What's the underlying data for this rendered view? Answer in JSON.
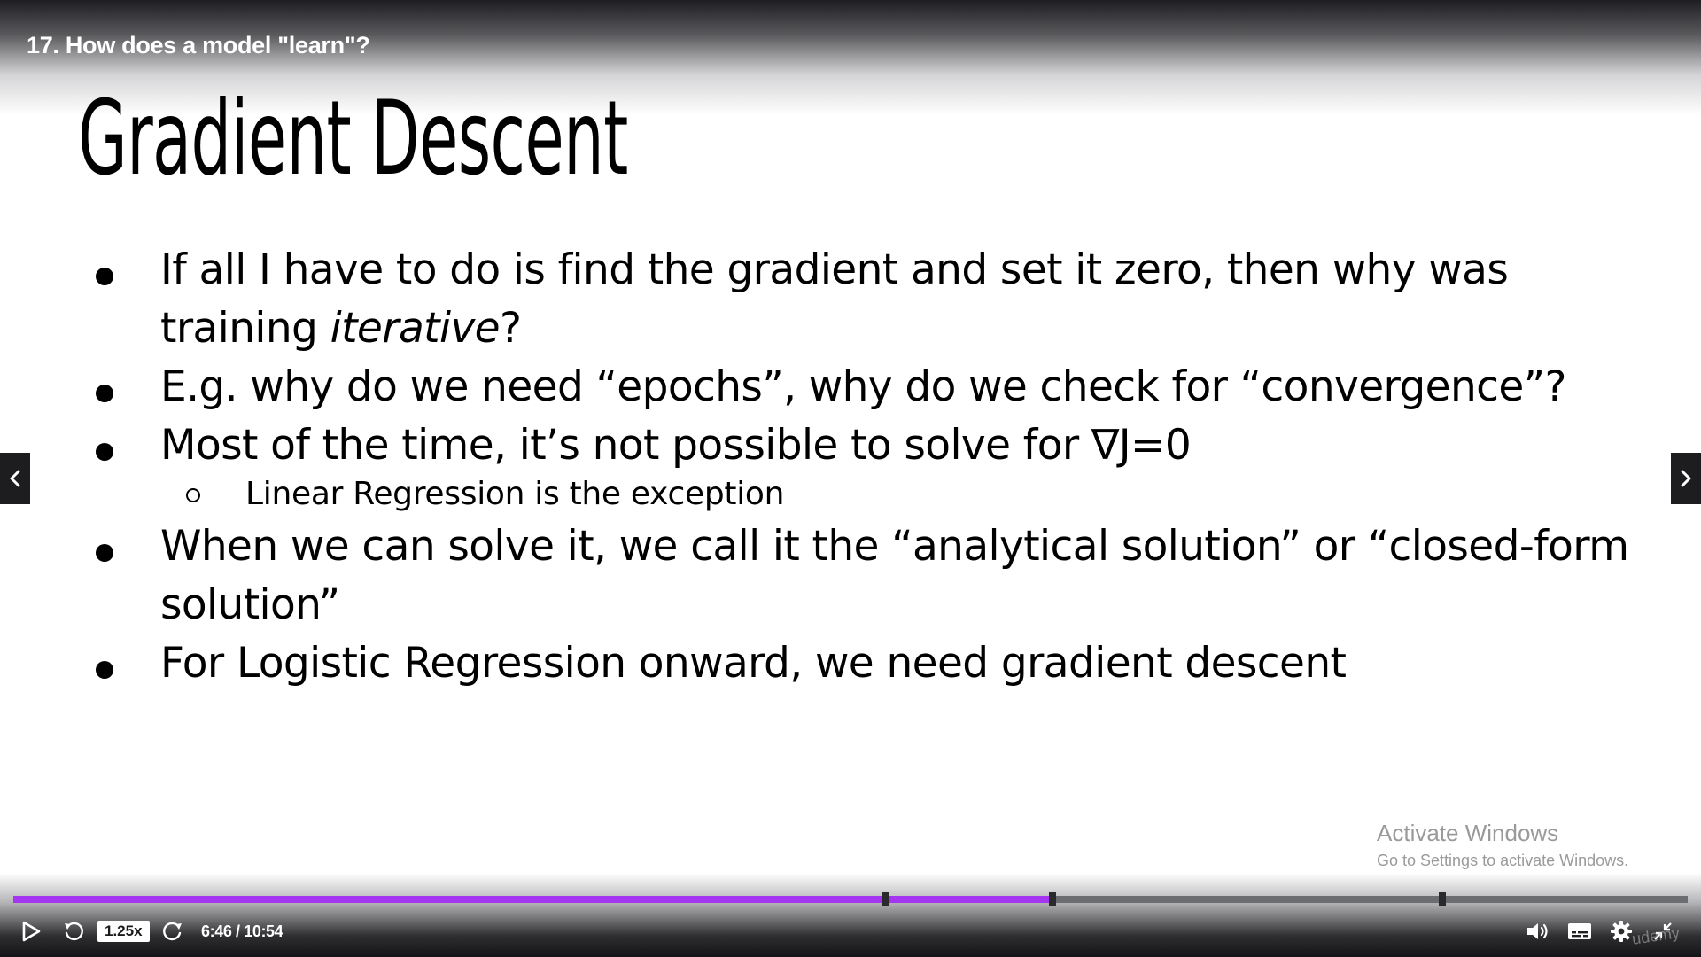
{
  "player": {
    "lecture_title": "17. How does a model \"learn\"?",
    "playback_speed": "1.25x",
    "time_display": "6:46 / 10:54",
    "progress_fraction": 0.6207,
    "chapter_markers_fraction": [
      0.5213,
      0.6207,
      0.8533
    ],
    "colors": {
      "progress_fill": "#a435f0",
      "progress_track": "#6b6d70"
    },
    "icons": [
      "play-icon",
      "rewind-icon",
      "forward-icon",
      "volume-icon",
      "captions-icon",
      "settings-icon",
      "exit-fullscreen-icon",
      "chevron-left-icon",
      "chevron-right-icon"
    ]
  },
  "slide": {
    "heading": "Gradient Descent",
    "bullets": [
      {
        "text_before": "If all I have to do is find the gradient and set it zero, then why was training",
        "text_italic": "iterative",
        "text_after": "?"
      },
      {
        "text": "E.g. why do we need “epochs”, why do we check for “convergence”?"
      },
      {
        "text": "Most of the time, it’s not possible to solve for ∇J=0"
      },
      {
        "text": "When we can solve it, we call it the “analytical solution” or “closed-form solution”"
      },
      {
        "text": "For Logistic Regression onward, we need gradient descent"
      }
    ],
    "sub_bullets": [
      {
        "text": "Linear Regression is the exception"
      }
    ]
  },
  "overlay": {
    "activate_title": "Activate Windows",
    "activate_subtitle": "Go to Settings to activate Windows.",
    "watermark": "udemy"
  }
}
